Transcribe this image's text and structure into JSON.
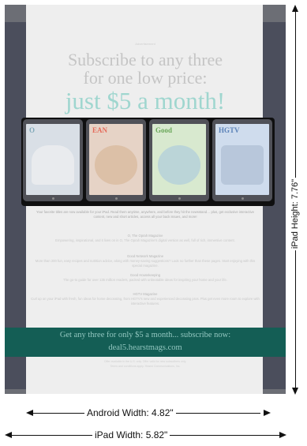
{
  "page": {
    "kicker": "Advertisement",
    "headline_line1": "Subscribe to any three",
    "headline_line2": "for one low price:",
    "headline_line3": "just $5 a month!"
  },
  "tablets": [
    {
      "cover": "O",
      "icon": "magazine-cover-icon"
    },
    {
      "cover": "EAN",
      "icon": "magazine-cover-icon"
    },
    {
      "cover": "Good",
      "icon": "magazine-cover-icon"
    },
    {
      "cover": "HGTV",
      "icon": "magazine-cover-icon"
    }
  ],
  "body": {
    "intro": "Your favorite titles are now available for your iPad. Read them anytime, anywhere, and before they hit the newsstand… plus, get exclusive interactive content, new and short articles, access all your back issues, and more!",
    "mag1_title": "O, The Oprah Magazine",
    "mag1_text": "Empowering, inspirational, and it lives on in O, The Oprah Magazine's digital version as well, full of rich, immersive content.",
    "mag2_title": "Good Network Magazine",
    "mag2_text": "More than 200 fun, easy recipes and nutrition advice, along with money-saving suggestions? Look no further than these pages. Start enjoying with this special magazine.",
    "mag3_title": "Good Housekeeping",
    "mag3_text": "The go-to guide for over 135 million readers, packed with unbeatable ideas for inspiring your home and your life.",
    "mag4_title": "HGTV Magazine",
    "mag4_text": "Curl up on your iPad with fresh, fun ideas for home decorating, from HGTV's new and experienced decorating pros. Plus get even more room to explore with interactive features."
  },
  "banner": {
    "line1": "Get any three for only $5 a month... subscribe now:",
    "line2": "deal5.hearstmags.com"
  },
  "footer": {
    "line1": "Offer available in the U.S. only. Offer valid for new subscribers only.",
    "line2": "Terms and conditions apply. Hearst Communications, Inc."
  },
  "dimensions": {
    "android_width": "Android Width: 4.82\"",
    "ipad_width": "iPad Width: 5.82\"",
    "ipad_height": "iPad Height: 7.76\""
  },
  "colors": {
    "ipad_frame": "#4b4e5c",
    "android_overlay": "#eeeeee",
    "banner": "#145e55",
    "headline_accent": "#9fd6cf"
  }
}
